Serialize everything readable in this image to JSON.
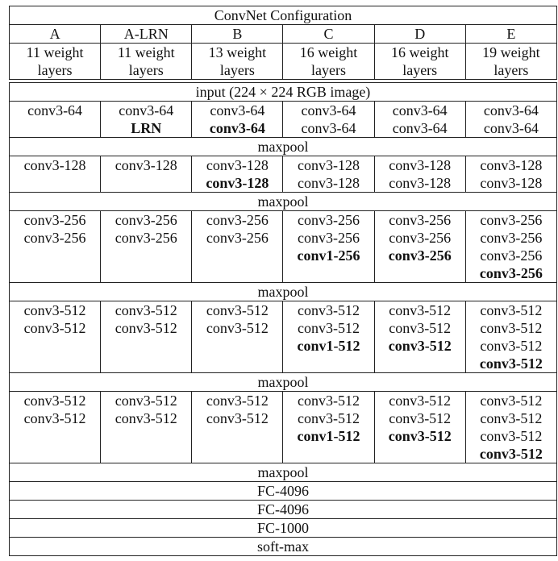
{
  "table": {
    "title": "ConvNet Configuration",
    "columns": [
      {
        "name": "A",
        "depth_line1": "11 weight",
        "depth_line2": "layers"
      },
      {
        "name": "A-LRN",
        "depth_line1": "11 weight",
        "depth_line2": "layers"
      },
      {
        "name": "B",
        "depth_line1": "13 weight",
        "depth_line2": "layers"
      },
      {
        "name": "C",
        "depth_line1": "16 weight",
        "depth_line2": "layers"
      },
      {
        "name": "D",
        "depth_line1": "16 weight",
        "depth_line2": "layers"
      },
      {
        "name": "E",
        "depth_line1": "19 weight",
        "depth_line2": "layers"
      }
    ],
    "input_row": "input (224 × 224 RGB image)",
    "blocks": [
      {
        "cells": [
          [
            {
              "t": "conv3-64",
              "b": false
            }
          ],
          [
            {
              "t": "conv3-64",
              "b": false
            },
            {
              "t": "LRN",
              "b": true
            }
          ],
          [
            {
              "t": "conv3-64",
              "b": false
            },
            {
              "t": "conv3-64",
              "b": true
            }
          ],
          [
            {
              "t": "conv3-64",
              "b": false
            },
            {
              "t": "conv3-64",
              "b": false
            }
          ],
          [
            {
              "t": "conv3-64",
              "b": false
            },
            {
              "t": "conv3-64",
              "b": false
            }
          ],
          [
            {
              "t": "conv3-64",
              "b": false
            },
            {
              "t": "conv3-64",
              "b": false
            }
          ]
        ],
        "pool": "maxpool"
      },
      {
        "cells": [
          [
            {
              "t": "conv3-128",
              "b": false
            }
          ],
          [
            {
              "t": "conv3-128",
              "b": false
            }
          ],
          [
            {
              "t": "conv3-128",
              "b": false
            },
            {
              "t": "conv3-128",
              "b": true
            }
          ],
          [
            {
              "t": "conv3-128",
              "b": false
            },
            {
              "t": "conv3-128",
              "b": false
            }
          ],
          [
            {
              "t": "conv3-128",
              "b": false
            },
            {
              "t": "conv3-128",
              "b": false
            }
          ],
          [
            {
              "t": "conv3-128",
              "b": false
            },
            {
              "t": "conv3-128",
              "b": false
            }
          ]
        ],
        "pool": "maxpool"
      },
      {
        "cells": [
          [
            {
              "t": "conv3-256",
              "b": false
            },
            {
              "t": "conv3-256",
              "b": false
            }
          ],
          [
            {
              "t": "conv3-256",
              "b": false
            },
            {
              "t": "conv3-256",
              "b": false
            }
          ],
          [
            {
              "t": "conv3-256",
              "b": false
            },
            {
              "t": "conv3-256",
              "b": false
            }
          ],
          [
            {
              "t": "conv3-256",
              "b": false
            },
            {
              "t": "conv3-256",
              "b": false
            },
            {
              "t": "conv1-256",
              "b": true
            }
          ],
          [
            {
              "t": "conv3-256",
              "b": false
            },
            {
              "t": "conv3-256",
              "b": false
            },
            {
              "t": "conv3-256",
              "b": true
            }
          ],
          [
            {
              "t": "conv3-256",
              "b": false
            },
            {
              "t": "conv3-256",
              "b": false
            },
            {
              "t": "conv3-256",
              "b": false
            },
            {
              "t": "conv3-256",
              "b": true
            }
          ]
        ],
        "pool": "maxpool"
      },
      {
        "cells": [
          [
            {
              "t": "conv3-512",
              "b": false
            },
            {
              "t": "conv3-512",
              "b": false
            }
          ],
          [
            {
              "t": "conv3-512",
              "b": false
            },
            {
              "t": "conv3-512",
              "b": false
            }
          ],
          [
            {
              "t": "conv3-512",
              "b": false
            },
            {
              "t": "conv3-512",
              "b": false
            }
          ],
          [
            {
              "t": "conv3-512",
              "b": false
            },
            {
              "t": "conv3-512",
              "b": false
            },
            {
              "t": "conv1-512",
              "b": true
            }
          ],
          [
            {
              "t": "conv3-512",
              "b": false
            },
            {
              "t": "conv3-512",
              "b": false
            },
            {
              "t": "conv3-512",
              "b": true
            }
          ],
          [
            {
              "t": "conv3-512",
              "b": false
            },
            {
              "t": "conv3-512",
              "b": false
            },
            {
              "t": "conv3-512",
              "b": false
            },
            {
              "t": "conv3-512",
              "b": true
            }
          ]
        ],
        "pool": "maxpool"
      },
      {
        "cells": [
          [
            {
              "t": "conv3-512",
              "b": false
            },
            {
              "t": "conv3-512",
              "b": false
            }
          ],
          [
            {
              "t": "conv3-512",
              "b": false
            },
            {
              "t": "conv3-512",
              "b": false
            }
          ],
          [
            {
              "t": "conv3-512",
              "b": false
            },
            {
              "t": "conv3-512",
              "b": false
            }
          ],
          [
            {
              "t": "conv3-512",
              "b": false
            },
            {
              "t": "conv3-512",
              "b": false
            },
            {
              "t": "conv1-512",
              "b": true
            }
          ],
          [
            {
              "t": "conv3-512",
              "b": false
            },
            {
              "t": "conv3-512",
              "b": false
            },
            {
              "t": "conv3-512",
              "b": true
            }
          ],
          [
            {
              "t": "conv3-512",
              "b": false
            },
            {
              "t": "conv3-512",
              "b": false
            },
            {
              "t": "conv3-512",
              "b": false
            },
            {
              "t": "conv3-512",
              "b": true
            }
          ]
        ],
        "pool": "maxpool"
      }
    ],
    "fc_rows": [
      "FC-4096",
      "FC-4096",
      "FC-1000",
      "soft-max"
    ]
  }
}
